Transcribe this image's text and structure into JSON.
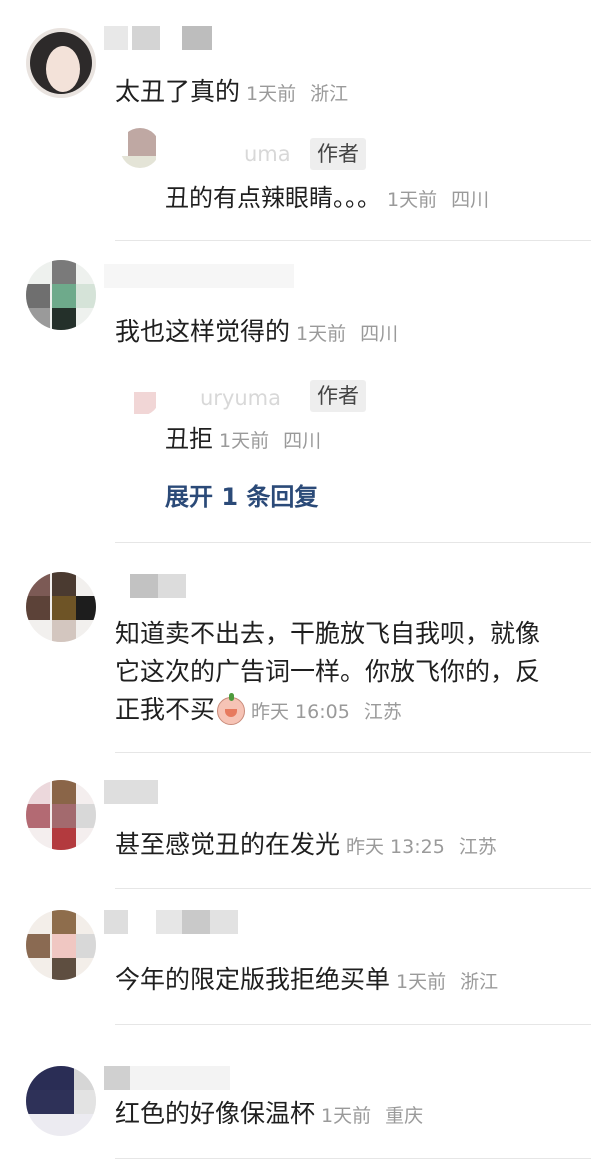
{
  "comments": [
    {
      "text": "太丑了真的",
      "time": "1天前",
      "location": "浙江",
      "reply": {
        "author_faded": "uma",
        "author_tag": "作者",
        "text": "丑的有点辣眼睛。。。",
        "time": "1天前",
        "location": "四川"
      }
    },
    {
      "text": "我也这样觉得的",
      "time": "1天前",
      "location": "四川",
      "reply": {
        "author_faded": "uryuma",
        "author_tag": "作者",
        "text": "丑拒",
        "time": "1天前",
        "location": "四川"
      },
      "expand_label": "展开 1 条回复"
    },
    {
      "text_line1": "知道卖不出去，干脆放飞自我呗，就像",
      "text_line2": "它这次的广告词一样。你放飞你的，反",
      "text_line3": "正我不买",
      "emoji": "peach-emoji",
      "time": "昨天 16:05",
      "location": "江苏"
    },
    {
      "text": "甚至感觉丑的在发光",
      "time": "昨天 13:25",
      "location": "江苏"
    },
    {
      "text": "今年的限定版我拒绝买单",
      "time": "1天前",
      "location": "浙江"
    },
    {
      "text": "红色的好像保温杯",
      "time": "1天前",
      "location": "重庆"
    }
  ]
}
